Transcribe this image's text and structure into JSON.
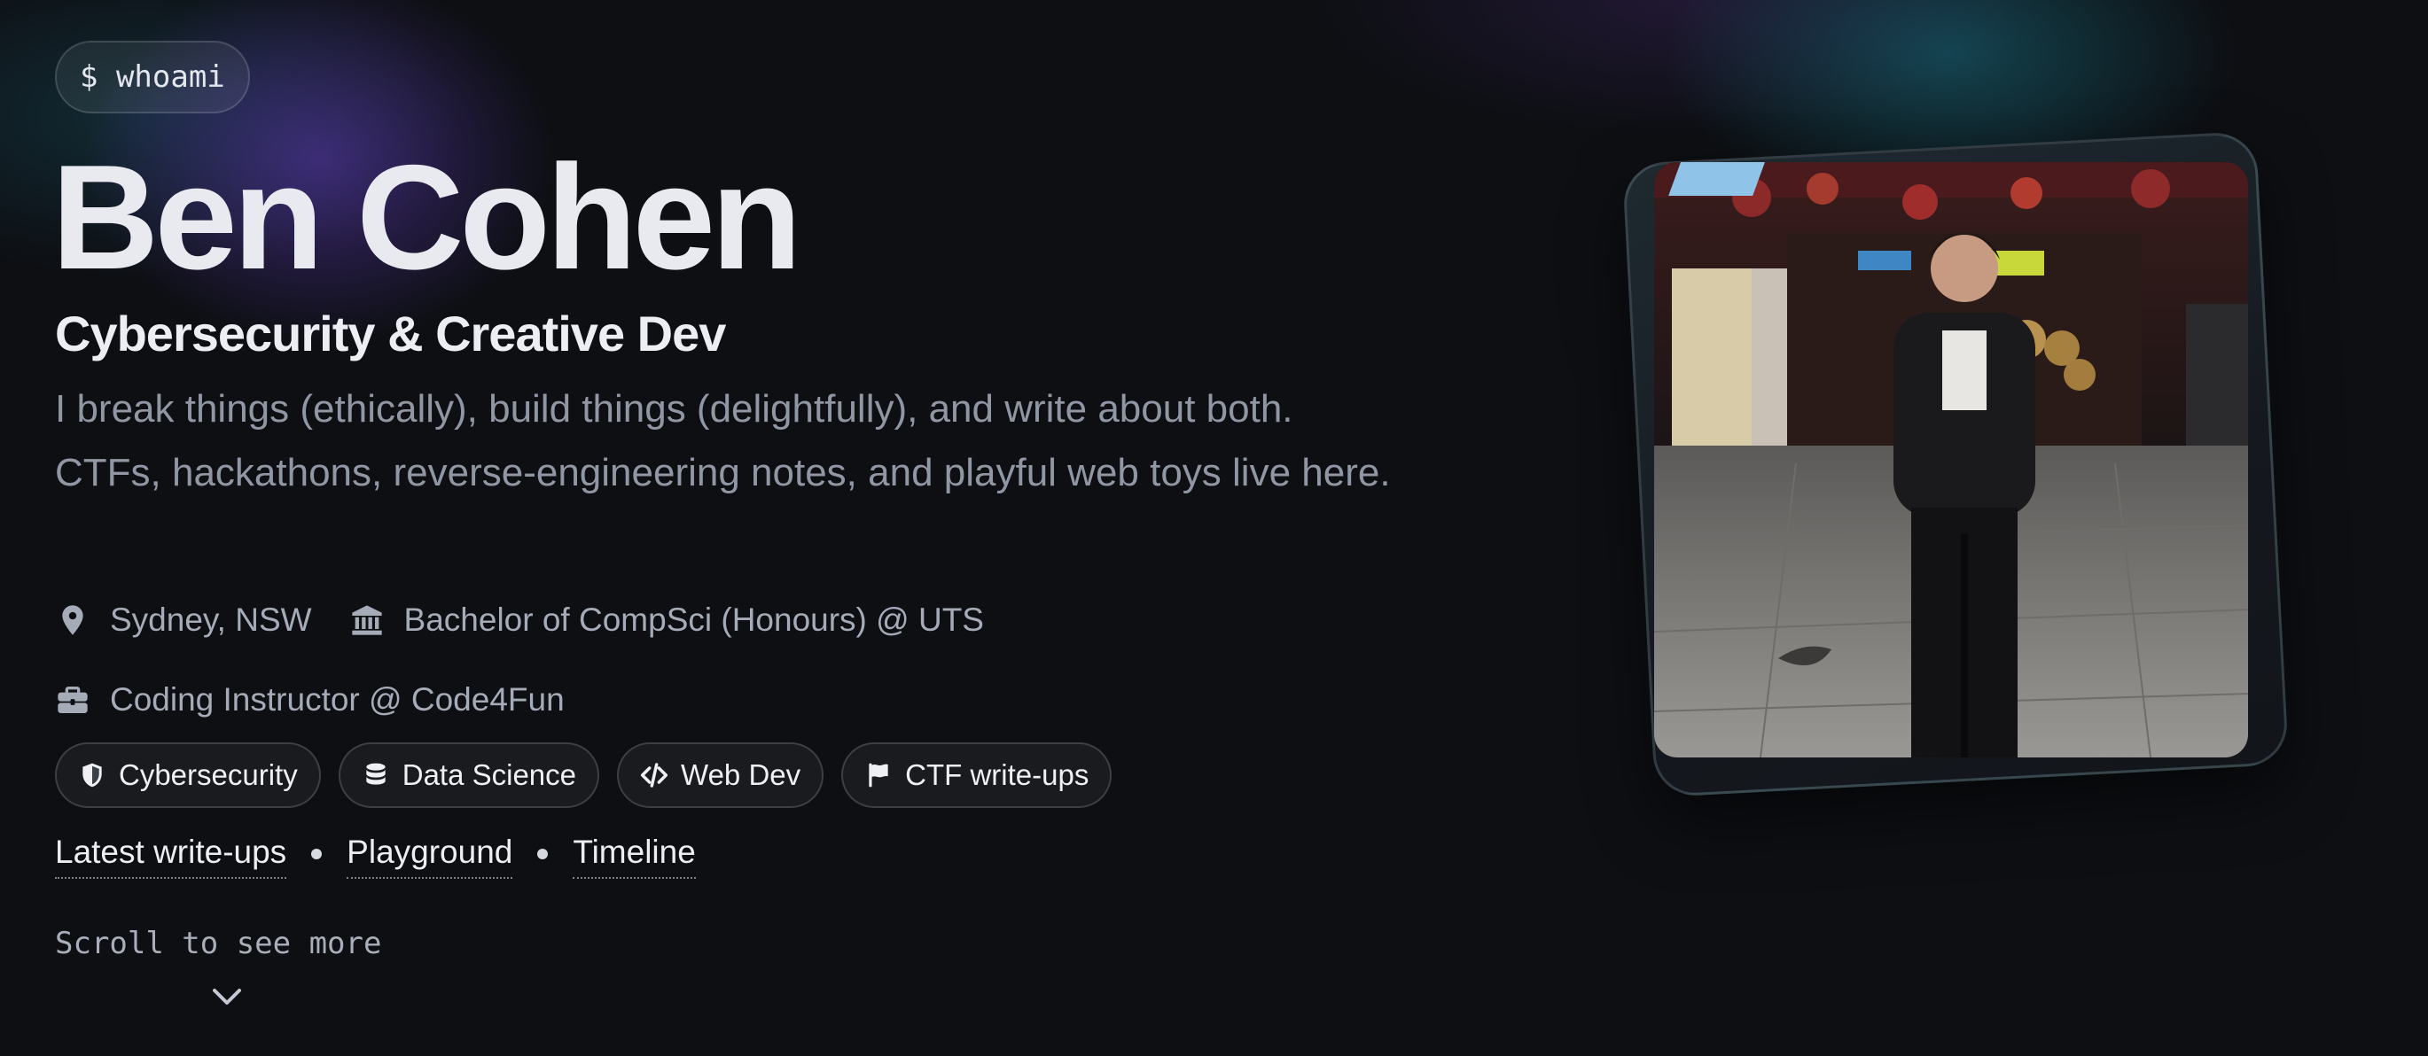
{
  "prompt": {
    "command": "$ whoami"
  },
  "hero": {
    "name": "Ben Cohen",
    "role": "Cybersecurity & Creative Dev",
    "bio": "I break things (ethically), build things (delightfully), and write about both. CTFs, hackathons, reverse-engineering notes, and playful web toys live here."
  },
  "meta": {
    "location": "Sydney, NSW",
    "education": "Bachelor of CompSci (Honours) @ UTS",
    "work": "Coding Instructor @ Code4Fun",
    "icons": {
      "location": "map-pin-icon",
      "education": "building-columns-icon",
      "work": "briefcase-icon"
    }
  },
  "tags": [
    {
      "label": "Cybersecurity",
      "icon": "shield-icon"
    },
    {
      "label": "Data Science",
      "icon": "database-icon"
    },
    {
      "label": "Web Dev",
      "icon": "code-icon"
    },
    {
      "label": "CTF write-ups",
      "icon": "flag-icon"
    }
  ],
  "links": [
    {
      "label": "Latest write-ups"
    },
    {
      "label": "Playground"
    },
    {
      "label": "Timeline"
    }
  ],
  "scroll": {
    "label": "Scroll to see more",
    "icon": "chevron-down-icon"
  },
  "colors": {
    "background": "#0d0f13",
    "heading": "#e8eaef",
    "muted": "#9097a3",
    "glow_purple": "#623cbe",
    "glow_teal": "#186e80"
  }
}
